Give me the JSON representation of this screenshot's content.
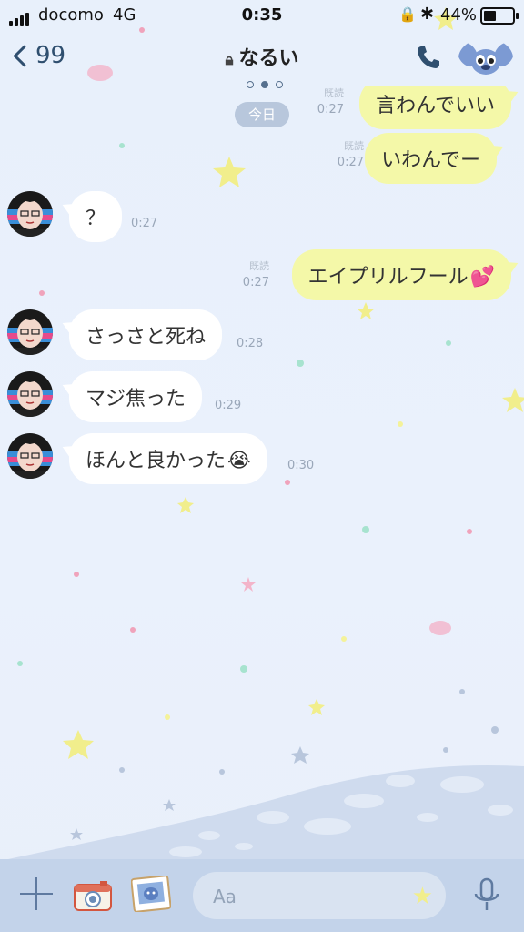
{
  "status_bar": {
    "carrier": "docomo",
    "network": "4G",
    "time": "0:35",
    "battery_percent": "44%",
    "battery_level": 0.44,
    "icons": [
      "signal-icon",
      "rotation-lock-icon",
      "bluetooth-icon",
      "battery-icon"
    ]
  },
  "header": {
    "back_count": "99",
    "title": "なるい",
    "title_icon": "lock-icon",
    "page_indicator": {
      "count": 3,
      "active": 2
    },
    "call_icon": "phone-icon"
  },
  "date_separator": "今日",
  "messages": [
    {
      "direction": "out",
      "text": "言わんでいい",
      "read": "既読",
      "time": "0:27"
    },
    {
      "direction": "out",
      "text": "いわんでー",
      "read": "既読",
      "time": "0:27"
    },
    {
      "direction": "in",
      "text": "？",
      "time": "0:27"
    },
    {
      "direction": "out",
      "text": "エイプリルフール",
      "emoji": "💕",
      "read": "既読",
      "time": "0:27"
    },
    {
      "direction": "in",
      "text": "さっさと死ね",
      "time": "0:28"
    },
    {
      "direction": "in",
      "text": "マジ焦った",
      "time": "0:29"
    },
    {
      "direction": "in",
      "text": "ほんと良かった",
      "emoji": "😭",
      "time": "0:30"
    }
  ],
  "input_bar": {
    "placeholder": "Aa",
    "icons": [
      "plus-icon",
      "camera-icon",
      "gallery-icon",
      "emoji-star-icon",
      "microphone-icon"
    ]
  },
  "colors": {
    "background": "#e9f0fb",
    "outgoing_bubble": "#f4f8a8",
    "incoming_bubble": "#ffffff",
    "input_bar": "#c3d3ea",
    "accent": "#2f4f6f"
  }
}
